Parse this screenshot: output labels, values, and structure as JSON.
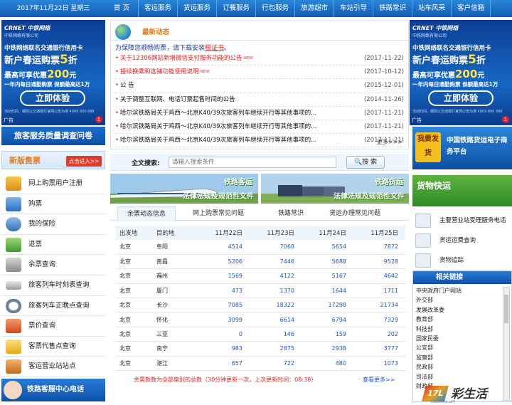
{
  "topbar": {
    "date": "2017年11月22日 星期三",
    "nav": [
      "首 页",
      "客运服务",
      "货运服务",
      "订餐服务",
      "行包服务",
      "旅游超市",
      "车站引导",
      "铁路常识",
      "站车风采",
      "客户信箱"
    ]
  },
  "ad": {
    "brand": "CRNET 中铁网络",
    "brand_sub": "中铁网络有限公司",
    "line1": "中铁网络联名交通银行信用卡",
    "line2_pre": "新户春运购票",
    "line2_num": "5",
    "line2_post": "折",
    "line3_pre": "最高可享优惠",
    "line3_num": "200",
    "line3_post": "元",
    "line4": "一年内每日通勤购票 保额最高达1万",
    "button": "立即体验",
    "fine_print": "活动时间、细则以交通银行官网公告为准 4009 800 888",
    "tag": "广告",
    "badge": "1"
  },
  "left": {
    "survey": "旅客服务质量调查问卷",
    "new_version": "新版售票",
    "new_version_btn": "点击进入>>",
    "menu": [
      "网上购票用户注册",
      "购票",
      "我的保险",
      "退票",
      "余票查询",
      "旅客列车时刻表查询",
      "旅客列车正晚点查询",
      "票价查询",
      "客票代售点查询",
      "客运营业站站点"
    ],
    "hotline": "铁路客服中心电话"
  },
  "news": {
    "title": "最新动态",
    "notice_pre": "为保障您顺畅购票，请下载安装",
    "notice_link": "根证书",
    "notice_post": "。",
    "items": [
      {
        "text": "关于12306网站新增微信支付服务功能的公告",
        "date": "(2017-11-22)",
        "red": true,
        "new": true
      },
      {
        "text": "接续换乘和选铺功能使用说明",
        "date": "(2017-10-12)",
        "red": true,
        "new": true
      },
      {
        "text": "公 告",
        "date": "(2015-12-01)",
        "red": false,
        "new": false
      },
      {
        "text": "关于调整互联网、电话订票起售时间的公告",
        "date": "(2014-11-26)",
        "red": false,
        "new": false
      },
      {
        "text": "哈尔滨铁路局关于鸡西～北京K40/39次旅客列车继续开行等其他事项的...",
        "date": "(2017-11-21)",
        "red": false,
        "new": false
      },
      {
        "text": "哈尔滨铁路局关于鸡西～北京K40/39次旅客列车继续开行等其他事项的...",
        "date": "(2017-11-21)",
        "red": false,
        "new": false
      },
      {
        "text": "哈尔滨铁路局关于鸡西～北京K40/39次旅客列车继续开行等其他事项的...",
        "date": "(2017-11-21)",
        "red": false,
        "new": false
      }
    ],
    "new_tag": "NEW",
    "more": "更多>>>"
  },
  "search": {
    "label": "全文搜索:",
    "placeholder": "请输入搜索条件",
    "button": "搜 索"
  },
  "banners": [
    {
      "title": "铁路客运",
      "subtitle": "法律法规及规范性文件"
    },
    {
      "title": "铁路货运",
      "subtitle": "法律法规及规范性文件"
    }
  ],
  "tabs": [
    "余票动态信息",
    "网上购票常见问题",
    "铁路常识",
    "货运办理常见问题"
  ],
  "tickets": {
    "headers": [
      "出发地",
      "目的地",
      "11月22日",
      "11月23日",
      "11月24日",
      "11月25日"
    ],
    "rows": [
      [
        "北京",
        "阜阳",
        "4514",
        "7068",
        "5654",
        "7872"
      ],
      [
        "北京",
        "南昌",
        "5206",
        "7446",
        "5688",
        "9528"
      ],
      [
        "北京",
        "福州",
        "1569",
        "4122",
        "5167",
        "4642"
      ],
      [
        "北京",
        "厦门",
        "473",
        "1370",
        "1644",
        "1711"
      ],
      [
        "北京",
        "长沙",
        "7085",
        "18322",
        "17298",
        "21734"
      ],
      [
        "北京",
        "怀化",
        "3099",
        "6614",
        "6794",
        "7329"
      ],
      [
        "北京",
        "三亚",
        "0",
        "146",
        "159",
        "202"
      ],
      [
        "北京",
        "南宁",
        "983",
        "2875",
        "2938",
        "3777"
      ],
      [
        "北京",
        "湛江",
        "657",
        "722",
        "480",
        "1073"
      ]
    ],
    "note": "余票数数为全部席别的总数（30分钟更新一次，上次更新时间：08:38）",
    "more": "查看更多>>"
  },
  "right": {
    "freight_want": "我要发货",
    "freight_title": "中国铁路货运电子商务平台",
    "freight_banner": "货物快运",
    "menu": [
      "主要营业站受理服务电话",
      "货运运费查询",
      "货物追踪"
    ],
    "links_title": "相关链接",
    "links": [
      "中央政府门户网站",
      "外交部",
      "发展改革委",
      "教育部",
      "科技部",
      "国家民委",
      "公安部",
      "监察部",
      "民政部",
      "司法部",
      "财政部"
    ]
  },
  "logo": {
    "mark": "17L",
    "text": "彩生活",
    "sub": "COLOURFUL LIFE"
  },
  "colors": {
    "nav_blue": "#0f5cb3",
    "accent_orange": "#e8781a",
    "alert_red": "#d22222",
    "link_blue": "#1b54c8"
  }
}
